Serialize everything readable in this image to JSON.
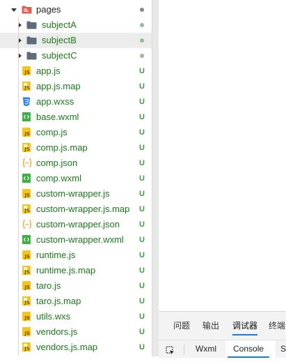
{
  "explorer": {
    "root": {
      "label": "pages",
      "status": "dot-gray"
    },
    "folders": [
      {
        "label": "subjectA",
        "status": "dot-green"
      },
      {
        "label": "subjectB",
        "status": "dot-green"
      },
      {
        "label": "subjectC",
        "status": "dot-green"
      }
    ],
    "files": [
      {
        "label": "app.js",
        "icon": "js",
        "status": "U"
      },
      {
        "label": "app.js.map",
        "icon": "map",
        "status": "U"
      },
      {
        "label": "app.wxss",
        "icon": "wxss",
        "status": "U"
      },
      {
        "label": "base.wxml",
        "icon": "wxml",
        "status": "U"
      },
      {
        "label": "comp.js",
        "icon": "js",
        "status": "U"
      },
      {
        "label": "comp.js.map",
        "icon": "map",
        "status": "U"
      },
      {
        "label": "comp.json",
        "icon": "json",
        "status": "U"
      },
      {
        "label": "comp.wxml",
        "icon": "wxml",
        "status": "U"
      },
      {
        "label": "custom-wrapper.js",
        "icon": "js",
        "status": "U"
      },
      {
        "label": "custom-wrapper.js.map",
        "icon": "map",
        "status": "U"
      },
      {
        "label": "custom-wrapper.json",
        "icon": "json",
        "status": "U"
      },
      {
        "label": "custom-wrapper.wxml",
        "icon": "wxml",
        "status": "U"
      },
      {
        "label": "runtime.js",
        "icon": "js",
        "status": "U"
      },
      {
        "label": "runtime.js.map",
        "icon": "map",
        "status": "U"
      },
      {
        "label": "taro.js",
        "icon": "js",
        "status": "U"
      },
      {
        "label": "taro.js.map",
        "icon": "map",
        "status": "U"
      },
      {
        "label": "utils.wxs",
        "icon": "js",
        "status": "U"
      },
      {
        "label": "vendors.js",
        "icon": "js",
        "status": "U"
      },
      {
        "label": "vendors.js.map",
        "icon": "map",
        "status": "U"
      }
    ]
  },
  "devtools": {
    "top_tabs": [
      "问题",
      "输出",
      "调试器",
      "终端"
    ],
    "active_top_tab": "调试器",
    "sub_tabs": [
      "Wxml",
      "Console",
      "S"
    ],
    "active_sub_tab": "Console"
  },
  "colors": {
    "git_untracked": "#3a9a3a",
    "filename_green": "#1a7a1a",
    "accent": "#1677ff",
    "js_icon": "#f5c518",
    "wxml_icon": "#3cb043",
    "wxss_icon": "#2b7de9",
    "folder_icon": "#5f6b7a",
    "root_folder_icon": "#e65a4e"
  }
}
